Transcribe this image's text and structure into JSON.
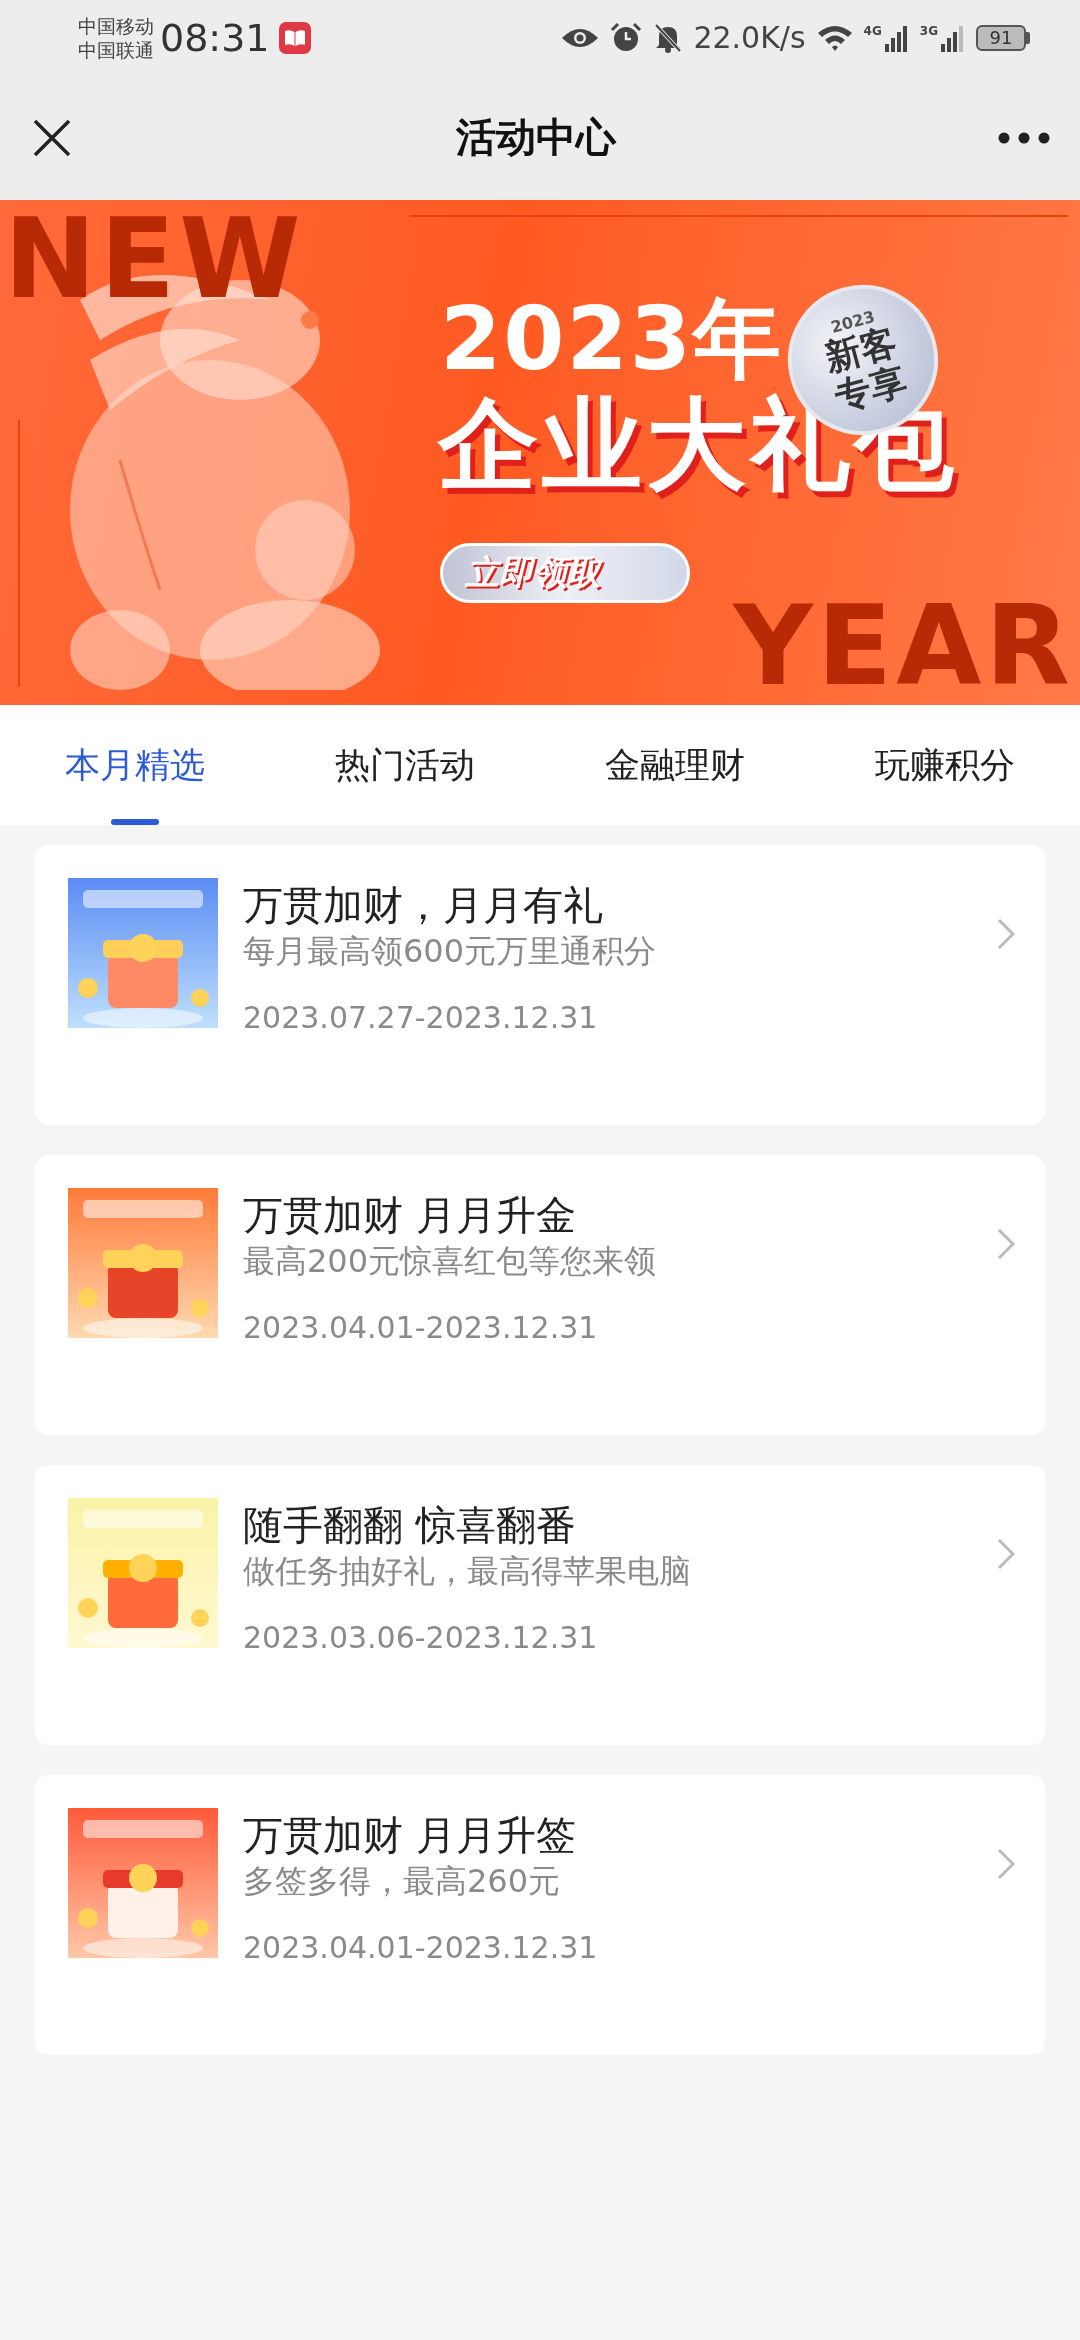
{
  "status_bar": {
    "carriers": [
      "中国移动",
      "中国联通"
    ],
    "time": "08:31",
    "net_speed": "22.0K/s",
    "networks": [
      "4G",
      "3G"
    ],
    "battery": "91"
  },
  "header": {
    "title": "活动中心"
  },
  "banner": {
    "corner_words": [
      "NEW",
      "YEAR"
    ],
    "year": "2023年",
    "headline": "企业大礼包",
    "badge_year": "2023",
    "badge_lines": [
      "新客",
      "专享"
    ],
    "button": "立即领取"
  },
  "tabs": [
    {
      "label": "本月精选",
      "selected": true
    },
    {
      "label": "热门活动",
      "selected": false
    },
    {
      "label": "金融理财",
      "selected": false
    },
    {
      "label": "玩赚积分",
      "selected": false
    }
  ],
  "activities": [
    {
      "title": "万贯加财，月月有礼",
      "subtitle": "每月最高领600元万里通积分",
      "period": "2023.07.27-2023.12.31"
    },
    {
      "title": "万贯加财 月月升金",
      "subtitle": "最高200元惊喜红包等您来领",
      "period": "2023.04.01-2023.12.31"
    },
    {
      "title": "随手翻翻 惊喜翻番",
      "subtitle": "做任务抽好礼，最高得苹果电脑",
      "period": "2023.03.06-2023.12.31"
    },
    {
      "title": "万贯加财 月月升签",
      "subtitle": "多签多得，最高260元",
      "period": "2023.04.01-2023.12.31"
    }
  ]
}
